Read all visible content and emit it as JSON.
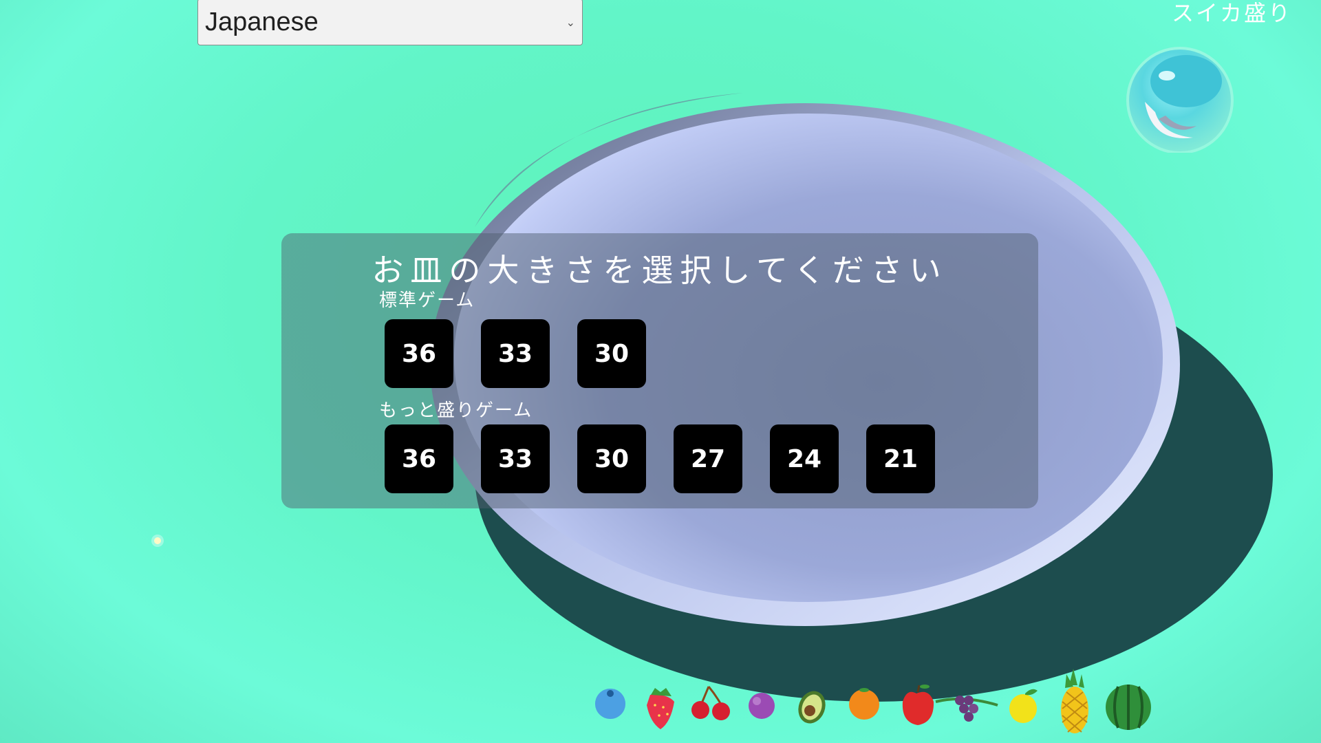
{
  "app": {
    "title": "スイカ盛り"
  },
  "language_select": {
    "selected": "Japanese"
  },
  "dialog": {
    "title": "お皿の大きさを選択してください",
    "standard": {
      "label": "標準ゲーム",
      "sizes": [
        "36",
        "33",
        "30"
      ]
    },
    "more": {
      "label": "もっと盛りゲーム",
      "sizes": [
        "36",
        "33",
        "30",
        "27",
        "24",
        "21"
      ]
    }
  },
  "fruits": [
    "blueberry-icon",
    "strawberry-icon",
    "cherry-icon",
    "plum-icon",
    "avocado-icon",
    "orange-icon",
    "apple-icon",
    "grapes-icon",
    "lemon-icon",
    "pineapple-icon",
    "watermelon-icon"
  ],
  "colors": {
    "background": "#62f5c8",
    "plate": "#a8b4e6",
    "plate_shadow": "#1d4d4e",
    "button": "#000000",
    "button_text": "#ffffff"
  }
}
